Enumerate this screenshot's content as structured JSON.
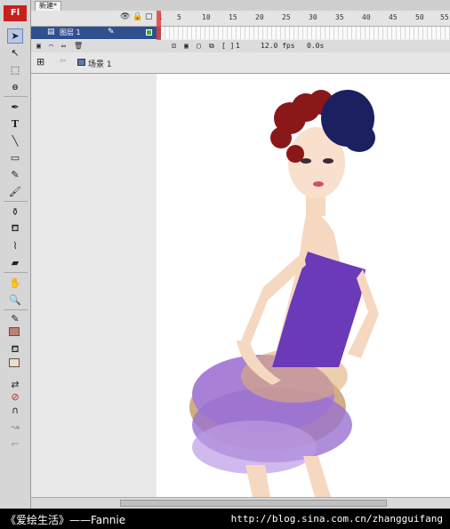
{
  "app": {
    "logo": "Fl"
  },
  "document_tab": "新建*",
  "timeline": {
    "ruler": [
      "1",
      "5",
      "10",
      "15",
      "20",
      "25",
      "30",
      "35",
      "40",
      "45",
      "50",
      "55"
    ],
    "layer_name": "图层 1",
    "current_frame": "1",
    "fps": "12.0 fps",
    "time": "0.0s"
  },
  "editbar": {
    "scene": "场景 1"
  },
  "tools": [
    "selection-icon",
    "subselection-icon",
    "free-transform-icon",
    "lasso-icon",
    "pen-icon",
    "text-icon",
    "line-icon",
    "rectangle-icon",
    "pencil-icon",
    "brush-icon",
    "ink-bottle-icon",
    "paint-bucket-icon",
    "eyedropper-icon",
    "eraser-icon",
    "hand-icon",
    "zoom-icon"
  ],
  "colors": {
    "stroke": "#c08070",
    "fill": "#f4dcc0",
    "accent": "#c8201e"
  },
  "caption": {
    "left": "《爱绘生活》——Fannie",
    "right": "http://blog.sina.com.cn/zhangguifang"
  }
}
